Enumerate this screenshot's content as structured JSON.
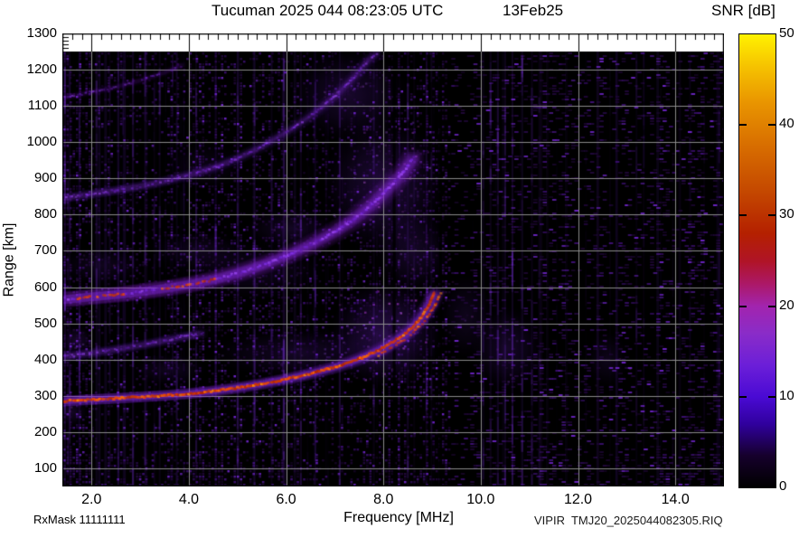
{
  "header": {
    "title": "Tucuman 2025 044 08:23:05 UTC",
    "date": "13Feb25",
    "colorbar_title": "SNR [dB]"
  },
  "axes": {
    "x_label": "Frequency [MHz]",
    "y_label": "Range [km]"
  },
  "footer": {
    "rx_mask": "RxMask 11111111",
    "file_id": "VIPIR  TMJ20_2025044082305.RIQ"
  },
  "chart_data": {
    "type": "heatmap",
    "title": "Tucuman 2025 044 08:23:05 UTC ionogram",
    "xlabel": "Frequency [MHz]",
    "ylabel": "Range [km]",
    "x_range": [
      1.4,
      15.0
    ],
    "y_range": [
      50,
      1300
    ],
    "x_major_ticks": [
      2,
      4,
      6,
      8,
      10,
      12,
      14
    ],
    "x_tick_labels": [
      "2.0",
      "4.0",
      "6.0",
      "8.0",
      "10.0",
      "12.0",
      "14.0"
    ],
    "x_minor_step": 0.2,
    "y_major_ticks": [
      100,
      200,
      300,
      400,
      500,
      600,
      700,
      800,
      900,
      1000,
      1100,
      1200,
      1300
    ],
    "y_minor_step": 10,
    "data_top_km": 1250,
    "grid_on": true,
    "grid_color": "#919191",
    "background_color": "#000000",
    "colorbar": {
      "min": 0,
      "max": 50,
      "tick_values": [
        0,
        10,
        20,
        30,
        40,
        50
      ],
      "marked_ticks": [
        10,
        20,
        30,
        40
      ],
      "gradient_stops": [
        [
          0.0,
          "#000000"
        ],
        [
          0.07,
          "#16002c"
        ],
        [
          0.14,
          "#30009e"
        ],
        [
          0.2,
          "#4a0ad4"
        ],
        [
          0.27,
          "#6c1fd8"
        ],
        [
          0.34,
          "#8a2cc8"
        ],
        [
          0.4,
          "#a224ae"
        ],
        [
          0.45,
          "#ac1866"
        ],
        [
          0.5,
          "#b01426"
        ],
        [
          0.56,
          "#b42000"
        ],
        [
          0.65,
          "#c44700"
        ],
        [
          0.75,
          "#d76c00"
        ],
        [
          0.85,
          "#e99500"
        ],
        [
          0.93,
          "#f6c300"
        ],
        [
          1.0,
          "#fff200"
        ]
      ]
    },
    "echo_traces": [
      {
        "hop": "1F",
        "strength": "strong",
        "palette": "hot",
        "points": [
          [
            1.4,
            285
          ],
          [
            2,
            290
          ],
          [
            2.5,
            293
          ],
          [
            3,
            297
          ],
          [
            3.5,
            301
          ],
          [
            4,
            306
          ],
          [
            4.5,
            313
          ],
          [
            5,
            322
          ],
          [
            5.5,
            333
          ],
          [
            6,
            346
          ],
          [
            6.5,
            361
          ],
          [
            7,
            379
          ],
          [
            7.3,
            392
          ],
          [
            7.6,
            407
          ],
          [
            7.9,
            426
          ],
          [
            8.2,
            449
          ],
          [
            8.45,
            471
          ],
          [
            8.65,
            496
          ],
          [
            8.8,
            521
          ],
          [
            8.95,
            554
          ],
          [
            9.05,
            589
          ]
        ]
      },
      {
        "hop": "1F-x",
        "strength": "medium",
        "palette": "hot",
        "points": [
          [
            7.9,
            412
          ],
          [
            8.2,
            436
          ],
          [
            8.5,
            462
          ],
          [
            8.8,
            500
          ],
          [
            9.05,
            545
          ],
          [
            9.2,
            590
          ]
        ]
      },
      {
        "hop": "1F-spread",
        "strength": "faint",
        "palette": "purple",
        "points": [
          [
            1.4,
            408
          ],
          [
            2,
            418
          ],
          [
            2.6,
            430
          ],
          [
            3.2,
            444
          ],
          [
            3.7,
            458
          ],
          [
            4.3,
            474
          ]
        ]
      },
      {
        "hop": "2F",
        "strength": "diffuse",
        "palette": "purple",
        "hot_spans": [
          [
            1.7,
            2.7
          ],
          [
            3.4,
            4.6
          ]
        ],
        "points": [
          [
            1.4,
            565
          ],
          [
            2,
            573
          ],
          [
            2.5,
            579
          ],
          [
            3,
            587
          ],
          [
            3.5,
            596
          ],
          [
            4,
            607
          ],
          [
            4.5,
            620
          ],
          [
            5,
            638
          ],
          [
            5.5,
            660
          ],
          [
            6,
            686
          ],
          [
            6.5,
            716
          ],
          [
            7,
            752
          ],
          [
            7.4,
            788
          ],
          [
            7.8,
            832
          ],
          [
            8.1,
            872
          ],
          [
            8.4,
            915
          ],
          [
            8.65,
            965
          ]
        ]
      },
      {
        "hop": "3F",
        "strength": "faint",
        "palette": "purple",
        "points": [
          [
            1.4,
            845
          ],
          [
            2,
            857
          ],
          [
            2.5,
            867
          ],
          [
            3,
            878
          ],
          [
            3.5,
            892
          ],
          [
            4,
            909
          ],
          [
            4.5,
            929
          ],
          [
            5,
            955
          ],
          [
            5.5,
            988
          ],
          [
            6,
            1027
          ],
          [
            6.5,
            1072
          ],
          [
            7,
            1126
          ],
          [
            7.4,
            1180
          ],
          [
            7.7,
            1227
          ],
          [
            7.9,
            1248
          ]
        ]
      },
      {
        "hop": "4F",
        "strength": "veryfaint",
        "palette": "purple",
        "points": [
          [
            1.4,
            1122
          ],
          [
            2,
            1138
          ],
          [
            2.5,
            1152
          ],
          [
            3,
            1170
          ],
          [
            3.5,
            1192
          ],
          [
            3.9,
            1215
          ]
        ]
      }
    ],
    "diffuse_clouds": [
      [
        8.05,
        470,
        1.15,
        150,
        0.5
      ],
      [
        6.3,
        418,
        1.9,
        70,
        0.26
      ],
      [
        3.6,
        372,
        0.8,
        45,
        0.2
      ],
      [
        1.7,
        452,
        0.35,
        45,
        0.3
      ],
      [
        1.6,
        255,
        0.35,
        40,
        0.25
      ],
      [
        8.0,
        880,
        1.25,
        190,
        0.4
      ],
      [
        5.3,
        645,
        1.5,
        80,
        0.2
      ],
      [
        2.2,
        660,
        0.9,
        55,
        0.2
      ],
      [
        4.2,
        700,
        1.0,
        55,
        0.2
      ],
      [
        6.1,
        762,
        0.95,
        60,
        0.24
      ],
      [
        8.6,
        700,
        0.8,
        120,
        0.28
      ],
      [
        7.3,
        1130,
        1.25,
        130,
        0.3
      ],
      [
        4.3,
        935,
        0.9,
        70,
        0.14
      ],
      [
        9.7,
        520,
        0.55,
        120,
        0.2
      ],
      [
        10.55,
        430,
        0.75,
        120,
        0.28
      ],
      [
        12.6,
        400,
        0.45,
        80,
        0.18
      ]
    ],
    "rfi_streaks": [
      [
        1.45,
        0.3
      ],
      [
        1.55,
        0.15
      ],
      [
        1.75,
        0.18
      ],
      [
        2.1,
        0.22
      ],
      [
        2.55,
        0.16
      ],
      [
        2.85,
        0.28
      ],
      [
        3.1,
        0.2
      ],
      [
        3.4,
        0.16
      ],
      [
        3.75,
        0.14
      ],
      [
        4.15,
        0.16
      ],
      [
        4.55,
        0.2
      ],
      [
        5.0,
        0.18
      ],
      [
        5.35,
        0.22
      ],
      [
        5.7,
        0.14
      ],
      [
        5.95,
        0.26
      ],
      [
        6.3,
        0.2
      ],
      [
        6.6,
        0.16
      ],
      [
        7.1,
        0.18
      ],
      [
        7.8,
        0.13
      ],
      [
        8.5,
        0.16
      ],
      [
        10.05,
        0.14
      ],
      [
        10.2,
        0.18
      ],
      [
        10.35,
        0.26
      ],
      [
        10.5,
        0.22
      ],
      [
        10.65,
        0.25
      ],
      [
        10.85,
        0.22
      ],
      [
        11.05,
        0.16
      ],
      [
        11.2,
        0.12
      ],
      [
        13.2,
        0.1
      ],
      [
        13.35,
        0.08
      ],
      [
        14.3,
        0.07
      ],
      [
        14.9,
        0.12
      ]
    ],
    "masked_freqs": [
      8.22,
      9.17
    ],
    "noise": {
      "seed": 1302,
      "density_low_band": 0.3,
      "density_high_band": 0.17,
      "band_split_mhz": 9.35
    }
  }
}
